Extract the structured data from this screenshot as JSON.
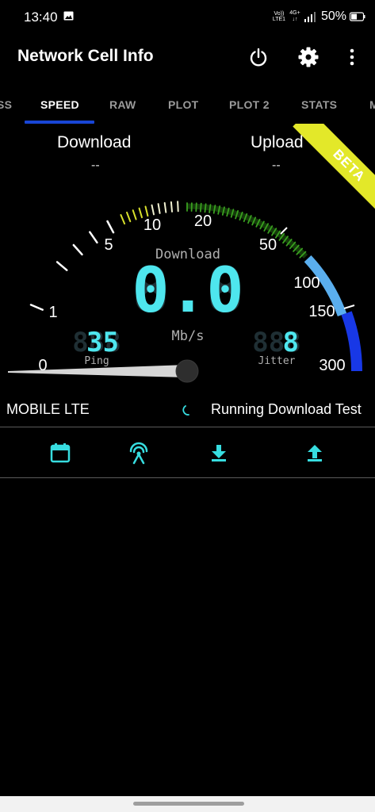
{
  "status_bar": {
    "time": "13:40",
    "volte_top": "Vo))",
    "volte_bottom": "LTE1",
    "network_type": "4G+",
    "network_arrows": "↓↑",
    "battery": "50%"
  },
  "app_bar": {
    "title": "Network Cell Info",
    "icons": [
      "power-icon",
      "gear-icon",
      "more-vert-icon"
    ]
  },
  "tabs": [
    {
      "label": "SS"
    },
    {
      "label": "SPEED",
      "active": true
    },
    {
      "label": "RAW"
    },
    {
      "label": "PLOT"
    },
    {
      "label": "PLOT 2"
    },
    {
      "label": "STATS"
    },
    {
      "label": "M"
    }
  ],
  "ribbon": "BETA",
  "summary": {
    "download_label": "Download",
    "download_value": "--",
    "upload_label": "Upload",
    "upload_value": "--"
  },
  "gauge": {
    "scale_labels": [
      "0",
      "1",
      "5",
      "10",
      "20",
      "50",
      "100",
      "150",
      "300"
    ],
    "mode_label": "Download",
    "speed_digits": "0.0",
    "unit": "Mb/s",
    "ping_value": "35",
    "ping_label": "Ping",
    "jitter_value": "8",
    "jitter_label": "Jitter",
    "needle_value": 0,
    "colors": {
      "ticks_white": "#ffffff",
      "ticks_yellow": "#d8e02c",
      "arc_green": "#3aa020",
      "arc_light_blue": "#5aaeee",
      "arc_blue": "#1838e6",
      "digits": "#4ee6ee",
      "digits_dim": "#1f2f34"
    }
  },
  "connection": {
    "type": "MOBILE LTE",
    "status": "Running Download Test"
  },
  "toolbar": {
    "icons": [
      "calendar-icon",
      "antenna-icon",
      "download-icon",
      "upload-icon"
    ],
    "accent": "#37dde0"
  }
}
